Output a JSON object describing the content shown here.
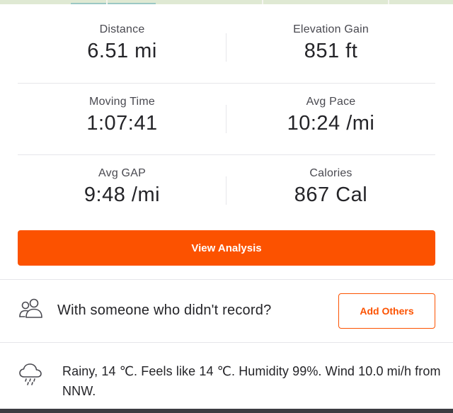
{
  "stats": {
    "rows": [
      [
        {
          "label": "Distance",
          "value": "6.51 mi"
        },
        {
          "label": "Elevation Gain",
          "value": "851 ft"
        }
      ],
      [
        {
          "label": "Moving Time",
          "value": "1:07:41"
        },
        {
          "label": "Avg Pace",
          "value": "10:24 /mi"
        }
      ],
      [
        {
          "label": "Avg GAP",
          "value": "9:48 /mi"
        },
        {
          "label": "Calories",
          "value": "867 Cal"
        }
      ]
    ]
  },
  "actions": {
    "view_analysis_label": "View Analysis"
  },
  "with_others": {
    "icon": "people-icon",
    "prompt": "With someone who didn't record?",
    "button_label": "Add Others"
  },
  "weather": {
    "icon": "rain-cloud-icon",
    "text": "Rainy, 14 ℃. Feels like 14 ℃. Humidity 99%. Wind 10.0 mi/h from NNW."
  },
  "colors": {
    "accent": "#fc5200",
    "divider": "#e6e6ea",
    "text": "#242428",
    "label": "#494950"
  }
}
